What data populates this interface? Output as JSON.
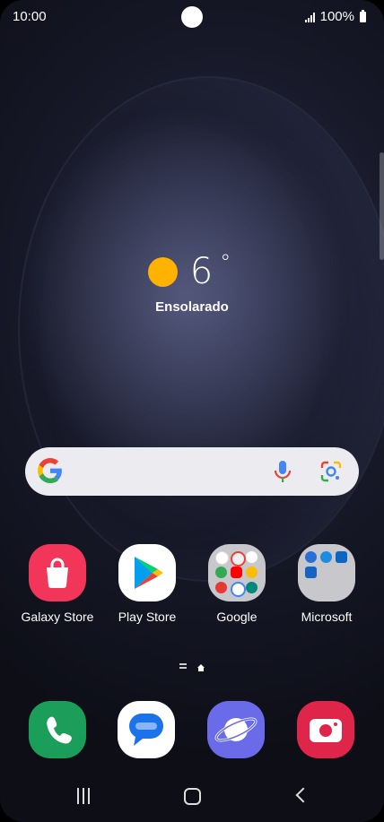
{
  "status_bar": {
    "time": "10:00",
    "battery": "100%"
  },
  "weather": {
    "temperature": "6",
    "degree_symbol": "°",
    "condition": "Ensolarado"
  },
  "search_bar": {
    "logo_icon": "google-g-icon",
    "mic_icon": "mic-icon",
    "lens_icon": "google-lens-icon"
  },
  "apps": [
    {
      "label": "Galaxy Store"
    },
    {
      "label": "Play Store"
    },
    {
      "label": "Google"
    },
    {
      "label": "Microsoft"
    }
  ],
  "dock": [
    {
      "icon": "phone-icon"
    },
    {
      "icon": "messages-icon"
    },
    {
      "icon": "internet-icon"
    },
    {
      "icon": "camera-icon"
    }
  ],
  "colors": {
    "galaxy_store": "#f2365a",
    "phone": "#1a9e5a",
    "internet": "#6a6be8",
    "camera": "#e0254a",
    "sun": "#ffb300"
  }
}
